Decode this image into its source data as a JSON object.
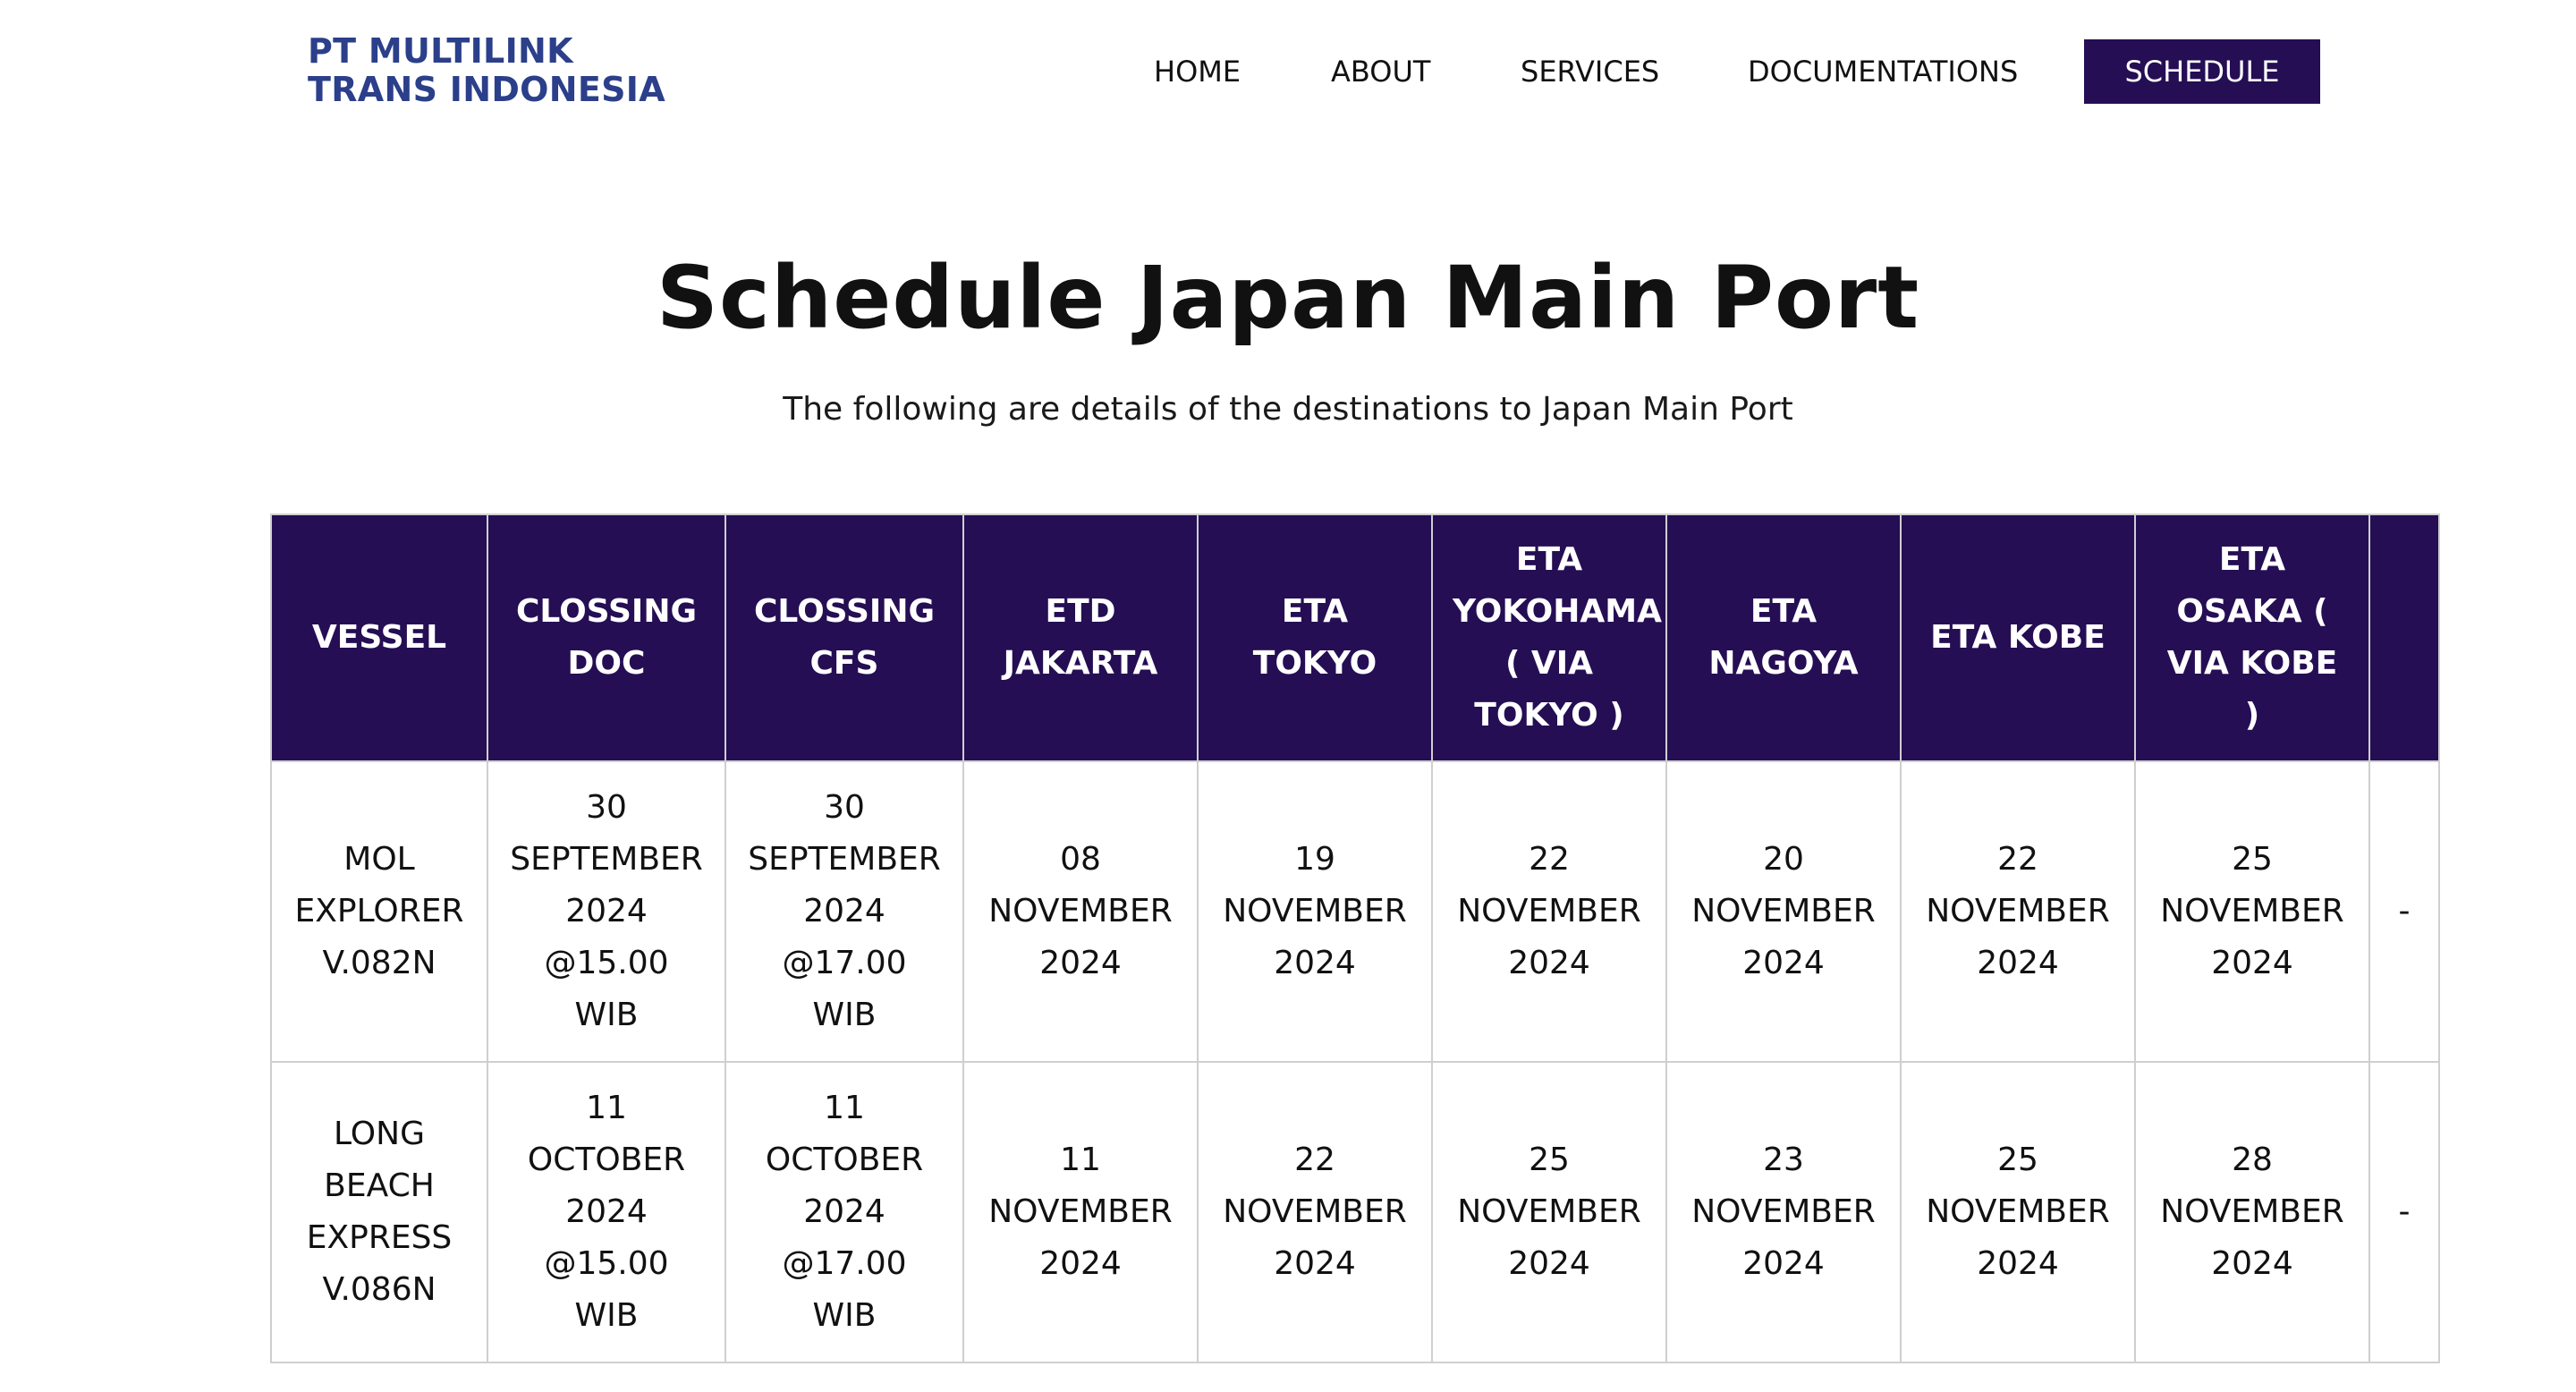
{
  "brand": {
    "line1": "PT MULTILINK",
    "line2": "TRANS INDONESIA",
    "color": "#2b3f8a"
  },
  "nav": {
    "items": [
      "HOME",
      "ABOUT",
      "SERVICES",
      "DOCUMENTATIONS",
      "SCHEDULE"
    ],
    "active": "SCHEDULE",
    "active_bg": "#250e54"
  },
  "page": {
    "title": "Schedule Japan Main Port",
    "subtitle": "The following are details of the destinations to Japan Main Port"
  },
  "schedule_table": {
    "header_bg": "#250e54",
    "columns": [
      "VESSEL",
      "CLOSSING DOC",
      "CLOSSING CFS",
      "ETD JAKARTA",
      "ETA TOKYO",
      "ETA YOKOHAMA ( VIA TOKYO )",
      "ETA NAGOYA",
      "ETA KOBE",
      "ETA OSAKA ( VIA KOBE )",
      ""
    ],
    "rows": [
      [
        "MOL EXPLORER V.082N",
        "30 SEPTEMBER 2024 @15.00 WIB",
        "30 SEPTEMBER 2024 @17.00 WIB",
        "08 NOVEMBER 2024",
        "19 NOVEMBER 2024",
        "22 NOVEMBER 2024",
        "20 NOVEMBER 2024",
        "22 NOVEMBER 2024",
        "25 NOVEMBER 2024",
        "-"
      ],
      [
        "LONG BEACH EXPRESS V.086N",
        "11 OCTOBER 2024 @15.00 WIB",
        "11 OCTOBER 2024 @17.00 WIB",
        "11 NOVEMBER 2024",
        "22 NOVEMBER 2024",
        "25 NOVEMBER 2024",
        "23 NOVEMBER 2024",
        "25 NOVEMBER 2024",
        "28 NOVEMBER 2024",
        "-"
      ]
    ]
  }
}
